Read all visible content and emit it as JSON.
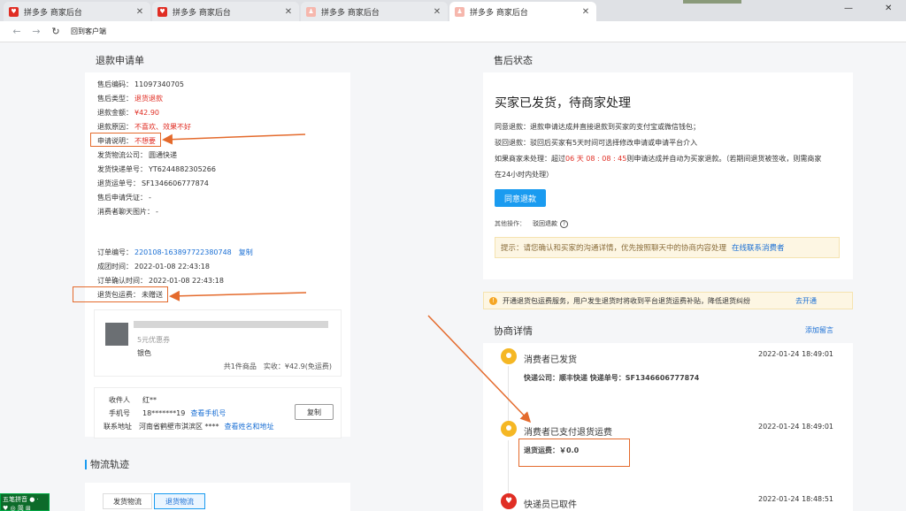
{
  "browser": {
    "tabs": [
      {
        "title": "拼多多 商家后台",
        "active": false
      },
      {
        "title": "拼多多 商家后台",
        "active": false
      },
      {
        "title": "拼多多 商家后台",
        "active": false
      },
      {
        "title": "拼多多 商家后台",
        "active": true
      }
    ],
    "back_label": "回到客户端"
  },
  "refund_form": {
    "title": "退款申请单",
    "fields": [
      {
        "label": "售后编码：",
        "value": "11097340705"
      },
      {
        "label": "售后类型：",
        "value": "退货退款"
      },
      {
        "label": "退款金额：",
        "value": "¥42.90"
      },
      {
        "label": "退款原因：",
        "value": "不喜欢、效果不好"
      },
      {
        "label": "申请说明：",
        "value": "不想要"
      },
      {
        "label": "发货物流公司：",
        "value": "圆通快递"
      },
      {
        "label": "发货快递单号：",
        "value": "YT6244882305266"
      },
      {
        "label": "退货运单号：",
        "value": "SF1346606777874"
      },
      {
        "label": "售后申请凭证：",
        "value": "-"
      },
      {
        "label": "消费者聊天图片：",
        "value": "-"
      }
    ],
    "order_no_label": "订单编号：",
    "order_no": "220108-163897722380748",
    "copy_label": "复制",
    "deal_time_label": "成团时间：",
    "deal_time": "2022-01-08 22:43:18",
    "confirm_time_label": "订单确认时间：",
    "confirm_time": "2022-01-08 22:43:18",
    "return_fee_label": "退货包运费：",
    "return_fee_value": "未赠送",
    "product": {
      "coupon": "5元优惠券",
      "variant": "银色",
      "summary": "共1件商品　实收：¥42.9(免运费)"
    },
    "receiver": {
      "name_label": "收件人",
      "name": "红**",
      "phone_label": "手机号",
      "phone": "18*******19",
      "phone_link": "查看手机号",
      "addr_label": "联系地址",
      "addr": "河南省鹤壁市淇滨区 ****",
      "addr_link": "查看姓名和地址",
      "copy_button": "复制"
    }
  },
  "logistics": {
    "title": "物流轨迹",
    "tabs": [
      "发货物流",
      "退货物流"
    ],
    "active_tab": 1
  },
  "after_sale": {
    "title": "售后状态",
    "headline": "买家已发货，待商家处理",
    "line1": "同意退款：退款申请达成并直接退款到买家的支付宝或微信钱包；",
    "line2": "驳回退款：驳回后买家有5天时间可选择修改申请或申请平台介入",
    "line3_pre": "如果商家未处理：超过",
    "line3_time": "06 天 08 : 08 : 45",
    "line3_post": "则申请达成并自动为买家退款。（若期间退货被签收，则需商家",
    "line4": "在24小时内处理）",
    "agree_button": "同意退款",
    "other_ops_label": "其他操作：",
    "reject_link": "驳回退款",
    "tip_text": "提示：请您确认和买家的沟通详情，优先按照聊天中的协商内容处理",
    "tip_link": "在线联系消费者"
  },
  "notice": {
    "text": "开通退货包运费服务，用户发生退货时将收到平台退货运费补贴，降低退货纠纷",
    "link": "去开通"
  },
  "negotiation": {
    "title": "协商详情",
    "add_note": "添加留言",
    "items": [
      {
        "title": "消费者已发货",
        "time": "2022-01-24 18:49:01",
        "detail": "快递公司：顺丰快递 快递单号：SF1346606777874"
      },
      {
        "title": "消费者已支付退货运费",
        "time": "2022-01-24 18:49:01",
        "detail": "退货运费：￥0.0"
      },
      {
        "title": "快递员已取件",
        "time": "2022-01-24 18:48:51",
        "detail": ""
      }
    ]
  },
  "ime": {
    "line1": "五笔拼音 ● ·",
    "line2": "♥ ◎ 简 ⊞"
  },
  "colors": {
    "accent_red": "#e02e24",
    "link_blue": "#1a6fd4",
    "annotation_orange": "#e46a2c",
    "button_blue": "#1a9bf0"
  }
}
